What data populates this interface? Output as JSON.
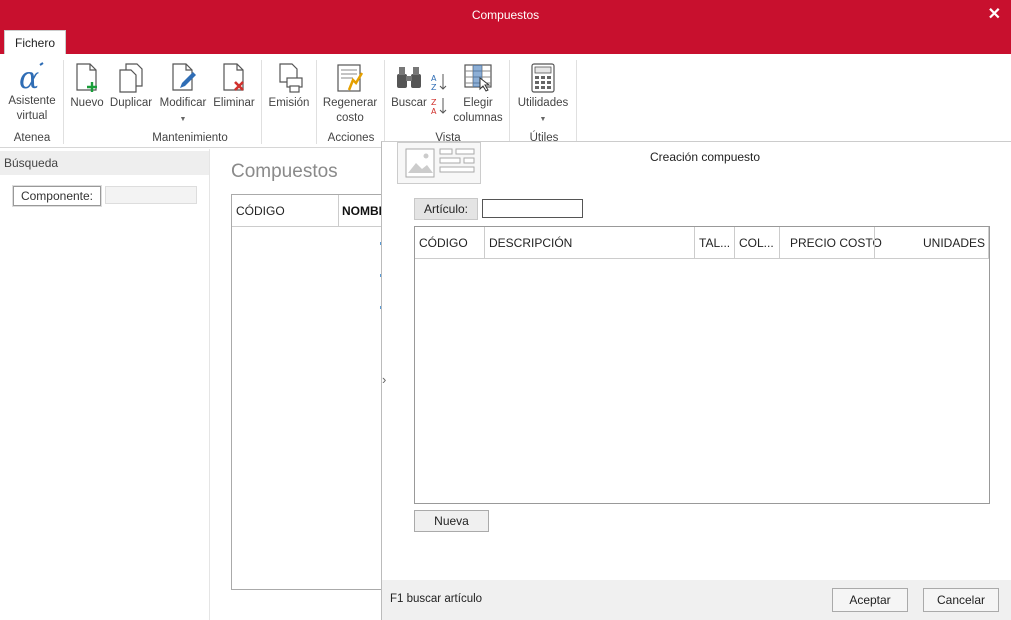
{
  "window": {
    "title": "Compuestos",
    "close": "✕"
  },
  "ribbon_tab": "Fichero",
  "ribbon": {
    "atenea": {
      "label": "Atenea",
      "asistente": "Asistente",
      "asistente2": "virtual"
    },
    "mantenimiento": {
      "label": "Mantenimiento",
      "nuevo": "Nuevo",
      "duplicar": "Duplicar",
      "modificar": "Modificar",
      "eliminar": "Eliminar",
      "emision": "Emisión"
    },
    "acciones": {
      "label": "Acciones",
      "regenerar": "Regenerar",
      "regenerar2": "costo"
    },
    "vista": {
      "label": "Vista",
      "buscar": "Buscar",
      "elegir": "Elegir",
      "elegir2": "columnas"
    },
    "utiles": {
      "label": "Útiles",
      "utilidades": "Utilidades"
    }
  },
  "sidebar": {
    "header": "Búsqueda",
    "componente_label": "Componente:"
  },
  "main": {
    "title": "Compuestos",
    "columns": [
      "CÓDIGO",
      "NOMBRE"
    ]
  },
  "dialog": {
    "title": "Creación compuesto",
    "articulo_label": "Artículo:",
    "articulo_value": "",
    "columns": [
      "CÓDIGO",
      "DESCRIPCIÓN",
      "TAL...",
      "COL...",
      "PRECIO COSTO",
      "UNIDADES"
    ],
    "nueva": "Nueva",
    "status": "F1 buscar artículo",
    "aceptar": "Aceptar",
    "cancelar": "Cancelar"
  },
  "colors": {
    "accent": "#c8102e",
    "icon_green": "#1a9e3a",
    "icon_red": "#d0312d",
    "icon_blue": "#2f6db5"
  }
}
